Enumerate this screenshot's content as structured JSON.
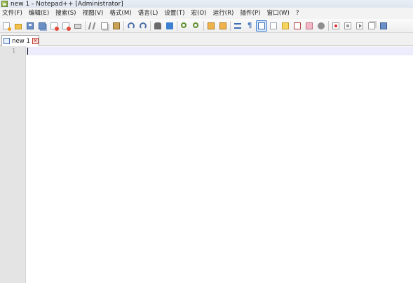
{
  "window": {
    "title": "new 1 - Notepad++ [Administrator]"
  },
  "menu": [
    {
      "label": "文件(F)"
    },
    {
      "label": "编辑(E)"
    },
    {
      "label": "搜索(S)"
    },
    {
      "label": "视图(V)"
    },
    {
      "label": "格式(M)"
    },
    {
      "label": "语言(L)"
    },
    {
      "label": "设置(T)"
    },
    {
      "label": "宏(O)"
    },
    {
      "label": "运行(R)"
    },
    {
      "label": "插件(P)"
    },
    {
      "label": "窗口(W)"
    },
    {
      "label": "?"
    }
  ],
  "toolbar": {
    "icons": [
      "new-file-icon",
      "open-file-icon",
      "save-icon",
      "save-all-icon",
      "close-icon",
      "close-all-icon",
      "print-icon",
      "cut-icon",
      "copy-icon",
      "paste-icon",
      "undo-icon",
      "redo-icon",
      "find-icon",
      "replace-icon",
      "zoom-in-icon",
      "zoom-out-icon",
      "sync-vertical-icon",
      "sync-horizontal-icon",
      "word-wrap-icon",
      "show-all-chars-icon",
      "indent-guide-icon",
      "user-lang-icon",
      "doc-map-icon",
      "function-list-icon",
      "folder-workspace-icon",
      "monitor-icon",
      "record-macro-icon",
      "stop-record-icon",
      "play-macro-icon",
      "run-macro-multiple-icon",
      "save-macro-icon"
    ],
    "selected": "indent-guide-icon"
  },
  "tabs": [
    {
      "label": "new 1",
      "active": true
    }
  ],
  "editor": {
    "line_numbers": [
      "1"
    ],
    "content": ""
  }
}
